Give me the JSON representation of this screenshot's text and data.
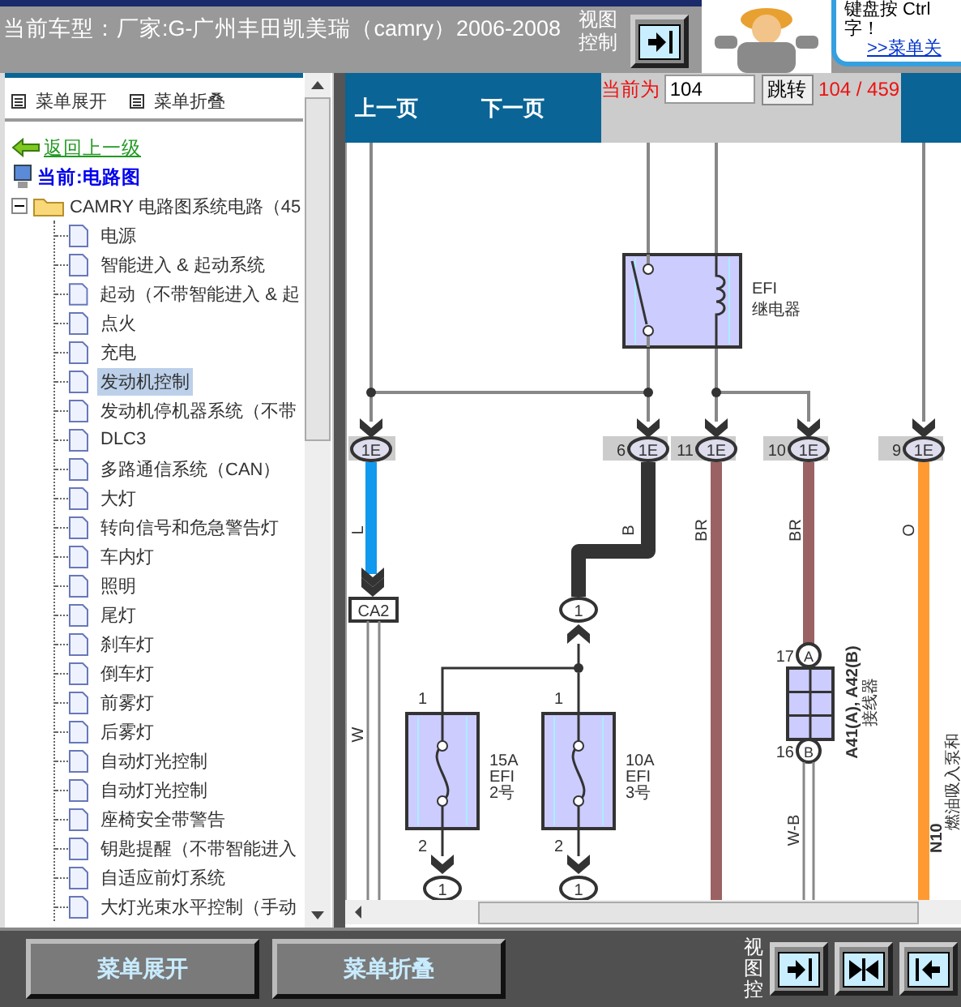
{
  "header": {
    "vehicle": "当前车型：厂家:G-广州丰田凯美瑞（camry）2006-2008",
    "view_control_label": "视图控制",
    "speech": [
      "键盘按 Ctrl",
      "字！"
    ],
    "speech_link": ">>菜单关"
  },
  "tree_toolbar": [
    "菜单展开",
    "菜单折叠"
  ],
  "nav": {
    "back_link": "返回上一级",
    "current": "当前:电路图"
  },
  "tree": {
    "label": "CAMRY 电路图系统电路（45",
    "expanded": true,
    "children": [
      {
        "label": "电源",
        "selected": false
      },
      {
        "label": "智能进入 & 起动系统",
        "selected": false
      },
      {
        "label": "起动（不带智能进入 & 起",
        "selected": false
      },
      {
        "label": "点火",
        "selected": false
      },
      {
        "label": "充电",
        "selected": false
      },
      {
        "label": "发动机控制",
        "selected": true
      },
      {
        "label": "发动机停机器系统（不带",
        "selected": false
      },
      {
        "label": "DLC3",
        "selected": false
      },
      {
        "label": "多路通信系统（CAN）",
        "selected": false
      },
      {
        "label": "大灯",
        "selected": false
      },
      {
        "label": "转向信号和危急警告灯",
        "selected": false
      },
      {
        "label": "车内灯",
        "selected": false
      },
      {
        "label": "照明",
        "selected": false
      },
      {
        "label": "尾灯",
        "selected": false
      },
      {
        "label": "刹车灯",
        "selected": false
      },
      {
        "label": "倒车灯",
        "selected": false
      },
      {
        "label": "前雾灯",
        "selected": false
      },
      {
        "label": "后雾灯",
        "selected": false
      },
      {
        "label": "自动灯光控制",
        "selected": false
      },
      {
        "label": "自动灯光控制",
        "selected": false
      },
      {
        "label": "座椅安全带警告",
        "selected": false
      },
      {
        "label": "钥匙提醒（不带智能进入",
        "selected": false
      },
      {
        "label": "自适应前灯系统",
        "selected": false
      },
      {
        "label": "大灯光束水平控制（手动",
        "selected": false
      }
    ]
  },
  "pager": {
    "prev": "上一页",
    "next": "下一页",
    "current_label": "当前为",
    "page_value": "104",
    "go_button": "跳转",
    "page_count": "104 / 459"
  },
  "diagram": {
    "top_connectors": [
      {
        "code": "1E",
        "wire": "L"
      },
      {
        "pin": "6",
        "code": "1E",
        "wire": "B"
      },
      {
        "pin": "11",
        "code": "1E",
        "wire": "BR"
      },
      {
        "pin": "10",
        "code": "1E",
        "wire": "BR"
      },
      {
        "pin": "9",
        "code": "1E",
        "wire": "O"
      }
    ],
    "relay": {
      "name": "EFI",
      "label": "继电器"
    },
    "lower_connector": "CA2",
    "lower_wire": "W",
    "splice": "1",
    "fuses": [
      {
        "rating": "15A",
        "name": "EFI",
        "number": "2号",
        "pin_in": "1",
        "pin_out": "2",
        "out_connector": "1"
      },
      {
        "rating": "10A",
        "name": "EFI",
        "number": "3号",
        "pin_in": "1",
        "pin_out": "2",
        "out_connector": "1"
      }
    ],
    "junction": {
      "pin_a": "17",
      "mark_a": "A",
      "pin_b": "16",
      "mark_b": "B",
      "code": "A41(A), A42(B)",
      "label": "接线器",
      "wire": "W-B"
    },
    "pump": {
      "code": "N10",
      "label": "燃油吸入泵和"
    }
  },
  "footer": {
    "buttons": [
      "菜单展开",
      "菜单折叠"
    ],
    "view_control_label": "视图控"
  }
}
